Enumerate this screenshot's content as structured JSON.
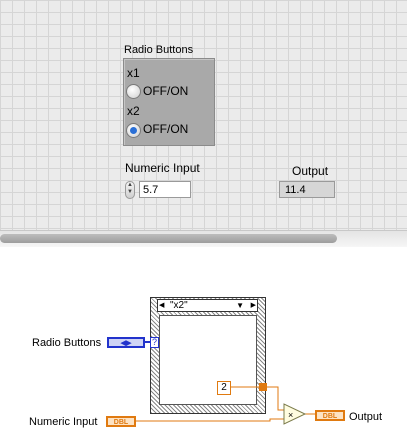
{
  "front_panel": {
    "radio_group_label": "Radio Buttons",
    "options": [
      {
        "caption": "x1",
        "label": "OFF/ON",
        "selected": false
      },
      {
        "caption": "x2",
        "label": "OFF/ON",
        "selected": true
      }
    ],
    "numeric_input_label": "Numeric Input",
    "numeric_input_value": "5.7",
    "output_label": "Output",
    "output_value": "11.4"
  },
  "block_diagram": {
    "radio_buttons_label": "Radio Buttons",
    "radio_terminal_type": "◀▶",
    "numeric_input_label": "Numeric Input",
    "numeric_terminal_type": "DBL",
    "output_label": "Output",
    "output_terminal_type": "DBL",
    "case_selector_value": "\"x2\"",
    "case_selector_arrow": "▼",
    "case_selector_left_arrow": "◀",
    "case_selector_right_arrow": "▶",
    "constant_value": "2",
    "selector_terminal": "?",
    "multiply_symbol": "×"
  },
  "colors": {
    "enum_wire": "#2233cc",
    "double_wire": "#e07a10",
    "panel_bg": "#ebebeb"
  }
}
